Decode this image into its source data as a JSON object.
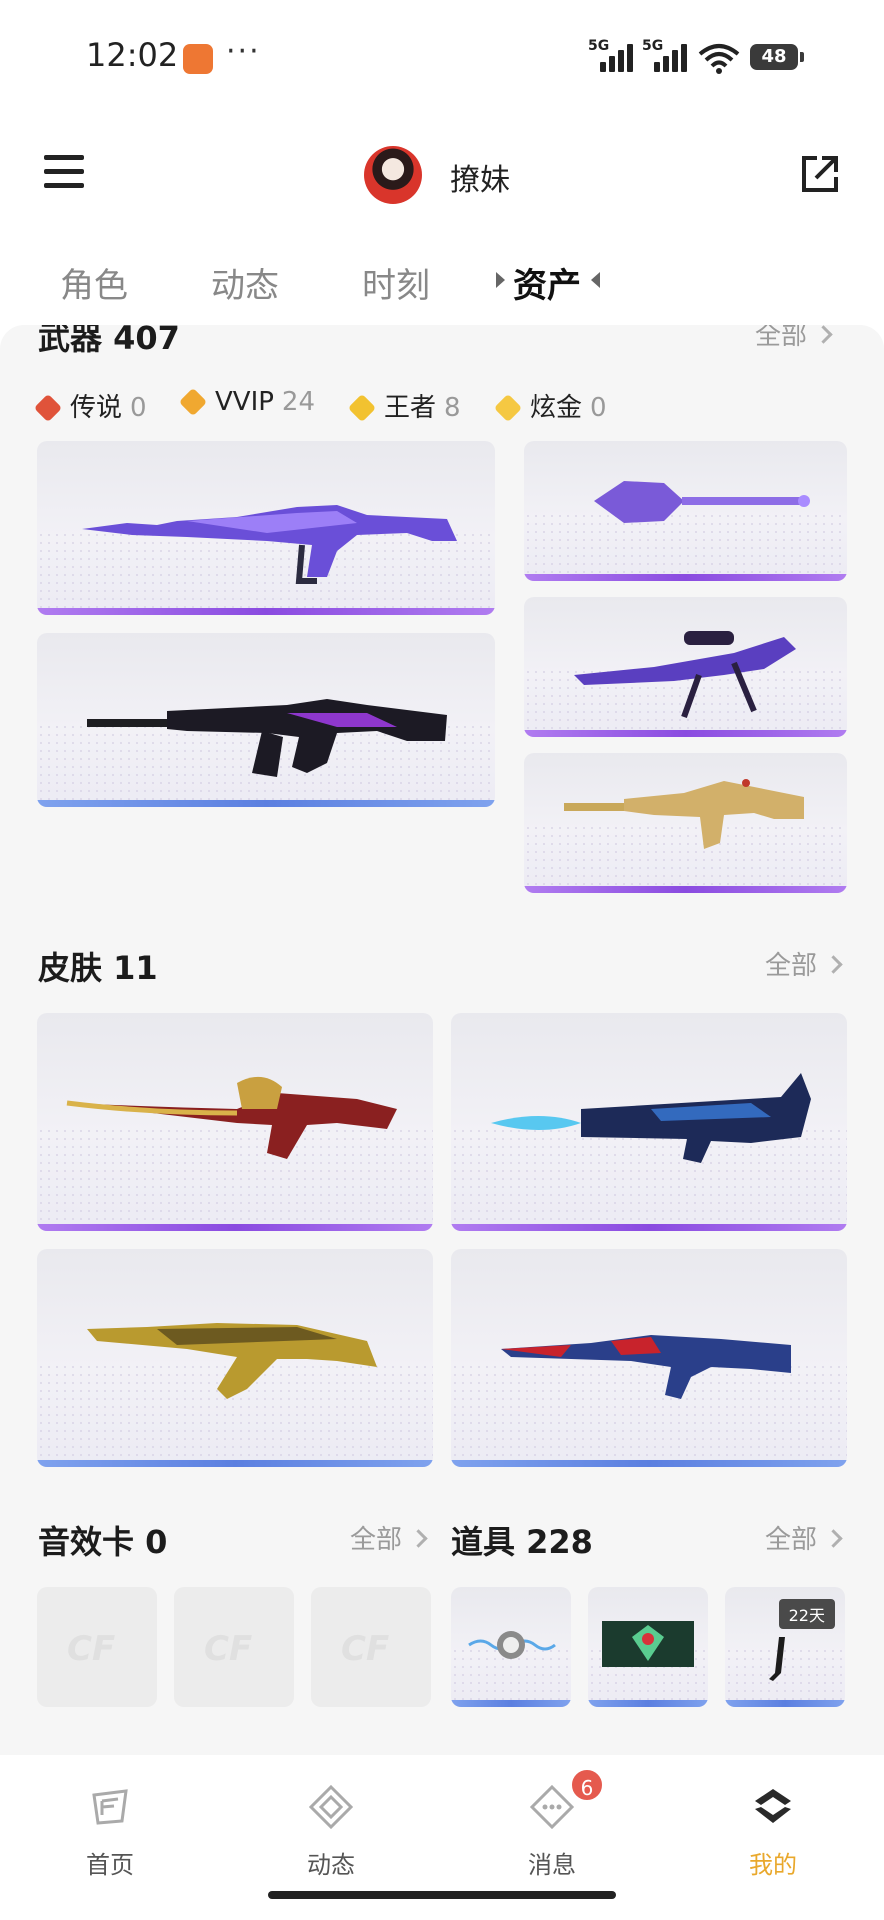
{
  "status_bar": {
    "time": "12:02",
    "more": "···",
    "signal1_label": "5G",
    "signal2_label": "5G",
    "battery": "48"
  },
  "header": {
    "nickname": "撩妹"
  },
  "tabs": [
    {
      "label": "角色",
      "active": false
    },
    {
      "label": "动态",
      "active": false
    },
    {
      "label": "时刻",
      "active": false
    },
    {
      "label": "资产",
      "active": true
    }
  ],
  "weapons": {
    "title": "武器 407",
    "all_label": "全部",
    "rarity": [
      {
        "name": "传说",
        "count": "0",
        "color": "#e0533a"
      },
      {
        "name": "VVIP",
        "count": "24",
        "color": "#f0a830"
      },
      {
        "name": "王者",
        "count": "8",
        "color": "#f2c230"
      },
      {
        "name": "炫金",
        "count": "0",
        "color": "#f5c842"
      }
    ]
  },
  "skins": {
    "title": "皮肤 11",
    "all_label": "全部"
  },
  "sound_cards": {
    "title": "音效卡 0",
    "all_label": "全部",
    "placeholder_logo": "CF"
  },
  "items": {
    "title": "道具 228",
    "all_label": "全部",
    "days_badge": "22天"
  },
  "bottom_nav": [
    {
      "label": "首页",
      "icon": "cf-home-icon",
      "active": false
    },
    {
      "label": "动态",
      "icon": "diamond-feed-icon",
      "active": false
    },
    {
      "label": "消息",
      "icon": "message-icon",
      "active": false,
      "badge": "6"
    },
    {
      "label": "我的",
      "icon": "profile-icon",
      "active": true
    }
  ],
  "colors": {
    "accent_gold": "#e9a82c",
    "rarity_purple": "#8a4be0",
    "rarity_blue": "#5b7fe0"
  }
}
